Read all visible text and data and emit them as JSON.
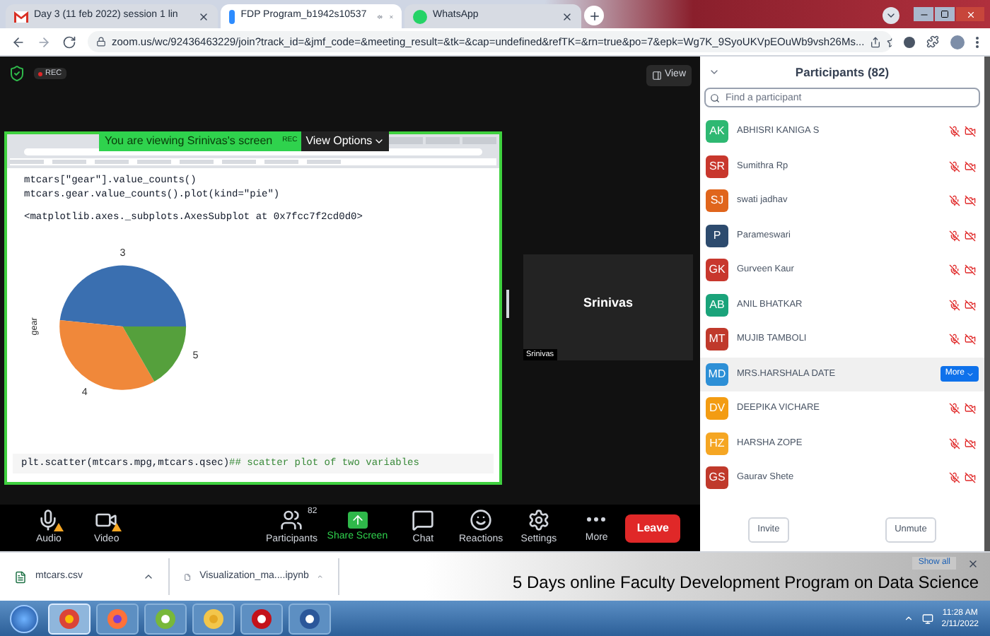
{
  "browser": {
    "tabs": [
      {
        "title": "Day 3 (11 feb 2022) session 1 lin",
        "selected": false,
        "kind": "mail"
      },
      {
        "title": "FDP Program_b1942s10537",
        "selected": true,
        "kind": "zoom"
      },
      {
        "title": "WhatsApp",
        "selected": false,
        "kind": "whatsapp"
      }
    ],
    "url": "zoom.us/wc/92436463229/join?track_id=&jmf_code=&meeting_result=&tk=&cap=undefined&refTK=&rn=true&po=7&epk=Wg7K_9SyoUKVpEOuWb9vsh26Ms..."
  },
  "meeting": {
    "rec": "REC",
    "view_button": "View",
    "share_banner": {
      "text": "You are viewing Srinivas's screen",
      "rec": "REC",
      "options": "View Options"
    },
    "notebook": {
      "cell_1": [
        "mtcars[\"gear\"].value_counts()",
        "mtcars.gear.value_counts().plot(kind=\"pie\")"
      ],
      "output": "<matplotlib.axes._subplots.AxesSubplot at 0x7fcc7f2cd0d0>",
      "pie": {
        "ylabel": "gear",
        "slices": [
          {
            "label": "3",
            "color": "#3a6fb0"
          },
          {
            "label": "4",
            "color": "#f0883a"
          },
          {
            "label": "5",
            "color": "#55a03c"
          }
        ]
      },
      "cell_2": {
        "code": "plt.scatter(mtcars.mpg,mtcars.qsec)",
        "comment": "## scatter plot of two variables"
      }
    },
    "video_tile": {
      "name": "Srinivas",
      "caption": "Srinivas"
    },
    "toolbar": [
      {
        "label": "Audio",
        "kind": "audio"
      },
      {
        "label": "Video",
        "kind": "video"
      },
      {
        "label": "Participants",
        "kind": "participants",
        "badge": "82"
      },
      {
        "label": "Share Screen",
        "kind": "share"
      },
      {
        "label": "Chat",
        "kind": "chat"
      },
      {
        "label": "Reactions",
        "kind": "reactions"
      },
      {
        "label": "Settings",
        "kind": "settings"
      },
      {
        "label": "More",
        "kind": "more"
      }
    ],
    "leave": "Leave"
  },
  "participants": {
    "title": "Participants (82)",
    "search": {
      "placeholder": "Find a participant"
    },
    "more_button": "More",
    "items": [
      {
        "initials": "AK",
        "name": "ABHISRI KANIGA S",
        "color": "#2eb872",
        "selected": false
      },
      {
        "initials": "SR",
        "name": "Sumithra Rp",
        "color": "#c8372d",
        "selected": false
      },
      {
        "initials": "SJ",
        "name": "swati jadhav",
        "color": "#e0651c",
        "selected": false
      },
      {
        "initials": "P",
        "name": "Parameswari",
        "color": "#2d4b6e",
        "selected": false
      },
      {
        "initials": "GK",
        "name": "Gurveen Kaur",
        "color": "#c8372d",
        "selected": false
      },
      {
        "initials": "AB",
        "name": "ANIL BHATKAR",
        "color": "#1aa37a",
        "selected": false
      },
      {
        "initials": "MT",
        "name": "MUJIB TAMBOLI",
        "color": "#c0392b",
        "selected": false
      },
      {
        "initials": "MD",
        "name": "MRS.HARSHALA DATE",
        "color": "#2d8fd6",
        "selected": true
      },
      {
        "initials": "DV",
        "name": "DEEPIKA VICHARE",
        "color": "#f39c12",
        "selected": false
      },
      {
        "initials": "HZ",
        "name": "HARSHA ZOPE",
        "color": "#f5a623",
        "selected": false
      },
      {
        "initials": "GS",
        "name": "Gaurav Shete",
        "color": "#c0392b",
        "selected": false
      }
    ],
    "buttons": [
      "Invite",
      "Unmute"
    ]
  },
  "downloads": {
    "items": [
      "mtcars.csv",
      "Visualization_ma....ipynb"
    ],
    "show_all": "Show all"
  },
  "caption": "5 Days online Faculty Development Program on Data Science",
  "taskbar": {
    "apps": [
      {
        "kind": "start"
      },
      {
        "kind": "chrome",
        "selected": true
      },
      {
        "kind": "firefox",
        "selected": false
      },
      {
        "kind": "torrent",
        "selected": false
      },
      {
        "kind": "folder",
        "selected": false
      },
      {
        "kind": "pdf",
        "selected": false
      },
      {
        "kind": "word",
        "selected": false
      }
    ],
    "time": "11:28 AM",
    "date": "2/11/2022"
  }
}
